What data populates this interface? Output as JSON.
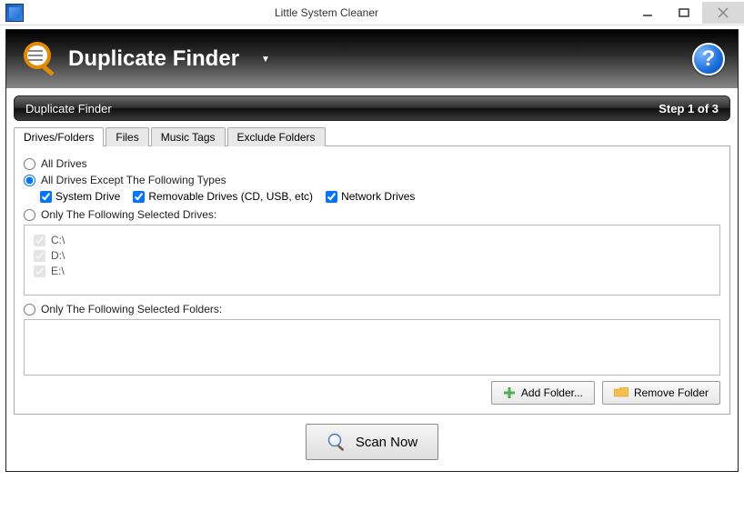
{
  "window": {
    "title": "Little System Cleaner"
  },
  "header": {
    "title": "Duplicate Finder"
  },
  "section": {
    "title": "Duplicate Finder",
    "step": "Step 1 of 3"
  },
  "tabs": {
    "drives_folders": "Drives/Folders",
    "files": "Files",
    "music_tags": "Music Tags",
    "exclude_folders": "Exclude Folders"
  },
  "options": {
    "all_drives": "All Drives",
    "all_drives_except": "All Drives Except The Following Types",
    "system_drive": "System Drive",
    "removable_drives": "Removable Drives (CD, USB, etc)",
    "network_drives": "Network Drives",
    "only_selected_drives": "Only The Following Selected Drives:",
    "only_selected_folders": "Only The Following Selected Folders:"
  },
  "drives": {
    "c": "C:\\",
    "d": "D:\\",
    "e": "E:\\"
  },
  "buttons": {
    "add_folder": "Add Folder...",
    "remove_folder": "Remove Folder",
    "scan_now": "Scan Now"
  }
}
